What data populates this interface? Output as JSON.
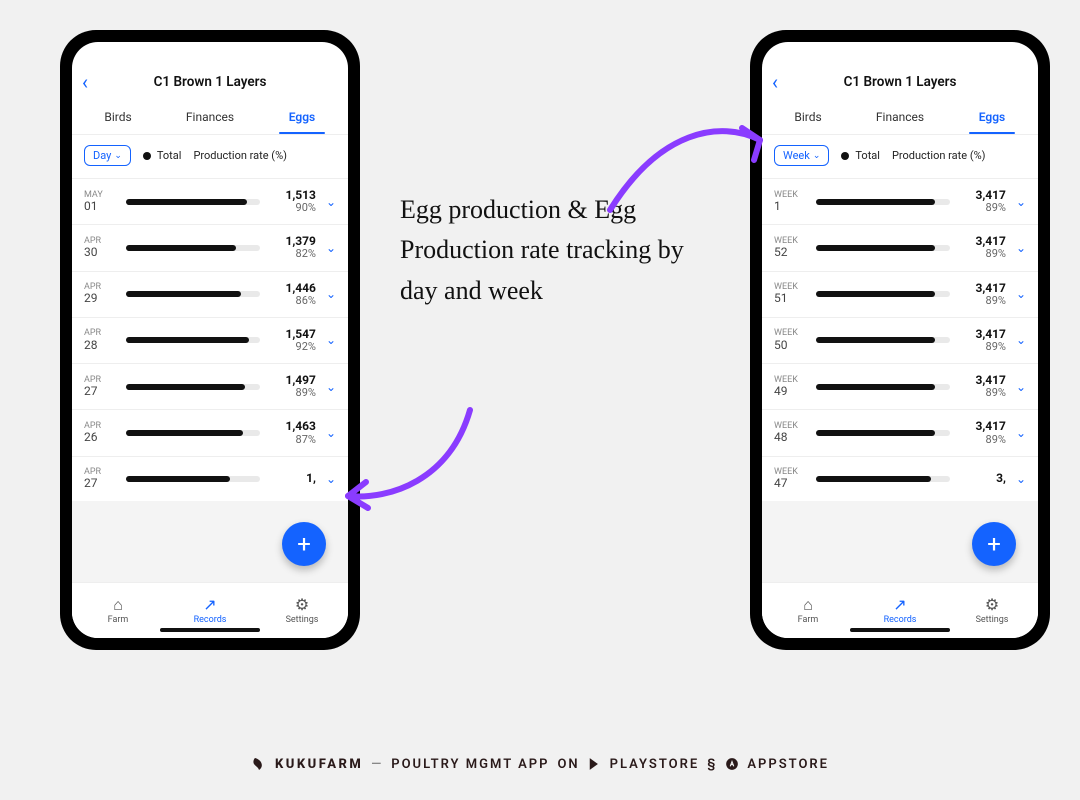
{
  "annotation_text": "Egg production & Egg Production rate tracking by day and week",
  "footer": {
    "brand": "KUKUFARM",
    "separator": "—",
    "tagline": "POULTRY MGMT APP",
    "on": "ON",
    "playstore": "PLAYSTORE",
    "section_mark": "§",
    "appstore": "APPSTORE"
  },
  "phones": {
    "day": {
      "page_title": "C1 Brown 1 Layers",
      "tabs": {
        "birds": "Birds",
        "finances": "Finances",
        "eggs": "Eggs"
      },
      "active_tab": "eggs",
      "filter_label": "Day",
      "legend_total": "Total",
      "legend_rate": "Production rate (%)",
      "fab_label": "+",
      "nav": {
        "farm": "Farm",
        "records": "Records",
        "settings": "Settings"
      },
      "rows": [
        {
          "period_label": "MAY",
          "period_value": "01",
          "total": "1,513",
          "rate": "90%",
          "bar_pct": 90
        },
        {
          "period_label": "APR",
          "period_value": "30",
          "total": "1,379",
          "rate": "82%",
          "bar_pct": 82
        },
        {
          "period_label": "APR",
          "period_value": "29",
          "total": "1,446",
          "rate": "86%",
          "bar_pct": 86
        },
        {
          "period_label": "APR",
          "period_value": "28",
          "total": "1,547",
          "rate": "92%",
          "bar_pct": 92
        },
        {
          "period_label": "APR",
          "period_value": "27",
          "total": "1,497",
          "rate": "89%",
          "bar_pct": 89
        },
        {
          "period_label": "APR",
          "period_value": "26",
          "total": "1,463",
          "rate": "87%",
          "bar_pct": 87
        },
        {
          "period_label": "APR",
          "period_value": "27",
          "total": "1,",
          "rate": "",
          "bar_pct": 78
        }
      ]
    },
    "week": {
      "page_title": "C1 Brown 1 Layers",
      "tabs": {
        "birds": "Birds",
        "finances": "Finances",
        "eggs": "Eggs"
      },
      "active_tab": "eggs",
      "filter_label": "Week",
      "legend_total": "Total",
      "legend_rate": "Production rate (%)",
      "fab_label": "+",
      "nav": {
        "farm": "Farm",
        "records": "Records",
        "settings": "Settings"
      },
      "rows": [
        {
          "period_label": "WEEK",
          "period_value": "1",
          "total": "3,417",
          "rate": "89%",
          "bar_pct": 89
        },
        {
          "period_label": "WEEK",
          "period_value": "52",
          "total": "3,417",
          "rate": "89%",
          "bar_pct": 89
        },
        {
          "period_label": "WEEK",
          "period_value": "51",
          "total": "3,417",
          "rate": "89%",
          "bar_pct": 89
        },
        {
          "period_label": "WEEK",
          "period_value": "50",
          "total": "3,417",
          "rate": "89%",
          "bar_pct": 89
        },
        {
          "period_label": "WEEK",
          "period_value": "49",
          "total": "3,417",
          "rate": "89%",
          "bar_pct": 89
        },
        {
          "period_label": "WEEK",
          "period_value": "48",
          "total": "3,417",
          "rate": "89%",
          "bar_pct": 89
        },
        {
          "period_label": "WEEK",
          "period_value": "47",
          "total": "3,",
          "rate": "",
          "bar_pct": 86
        }
      ]
    }
  }
}
